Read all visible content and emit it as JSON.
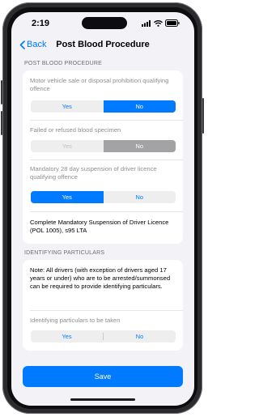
{
  "status_bar": {
    "time": "2:19"
  },
  "nav": {
    "back_label": "Back",
    "title": "Post Blood Procedure"
  },
  "sections": {
    "post_blood": {
      "header": "POST BLOOD PROCEDURE",
      "q1": {
        "label": "Motor vehicle sale or disposal prohibition qualifying offence",
        "yes": "Yes",
        "no": "No",
        "selected": "No"
      },
      "q2": {
        "label": "Failed or refused blood specimen",
        "yes": "Yes",
        "no": "No",
        "selected": "No"
      },
      "q3": {
        "label": "Mandatory 28 day suspension of driver licence qualifying offence",
        "yes": "Yes",
        "no": "No",
        "selected": "Yes"
      },
      "instruction": "Complete Mandatory Suspension of Driver Licence (POL 1005), s95 LTA"
    },
    "identifying": {
      "header": "IDENTIFYING PARTICULARS",
      "note": "Note: All drivers (with exception of drivers aged 17 years or under) who are to be arrested/summonsed can be required to provide identifying particulars.",
      "q4": {
        "label": "Identifying particulars to be taken",
        "yes": "Yes",
        "no": "No",
        "selected": ""
      }
    }
  },
  "save_label": "Save",
  "colors": {
    "accent": "#007aff",
    "disabled_selected": "#a3a3a6",
    "background": "#f2f2f7"
  }
}
